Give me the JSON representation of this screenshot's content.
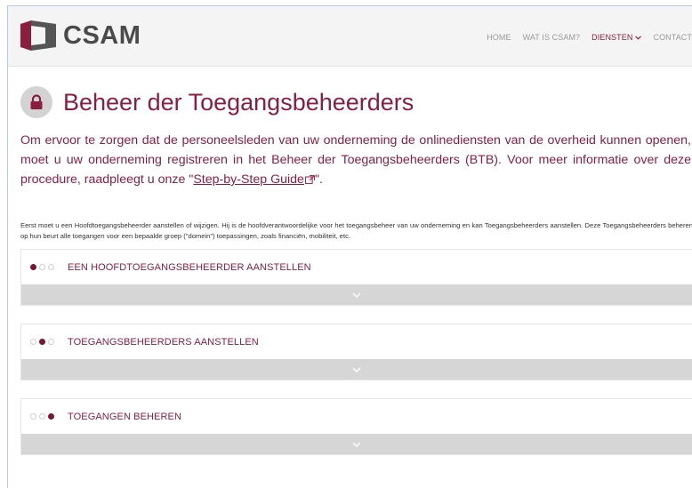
{
  "brand": {
    "name": "CSAM",
    "logo_icon": "csam-logo-icon",
    "accent": "#8b1e3f"
  },
  "nav": {
    "items": [
      {
        "label": "HOME"
      },
      {
        "label": "WAT IS CSAM?"
      },
      {
        "label": "DIENSTEN",
        "active": true,
        "chevron": "⌄"
      },
      {
        "label": "CONTACT"
      }
    ]
  },
  "page": {
    "title": "Beheer der Toegangsbeheerders",
    "icon": "lock-icon",
    "intro_before": "Om ervoor te zorgen dat de personeelsleden van uw onderneming de onlinediensten van de overheid kunnen openen, moet u uw onderneming registreren in het Beheer der Toegangsbeheerders (BTB). Voor meer informatie over deze procedure, raadpleegt u onze \"",
    "intro_link": "Step-by-Step Guide",
    "intro_after": "\".",
    "body": "Eerst moet u een Hoofdtoegangsbeheerder aanstellen of wijzigen. Hij is de hoofdverantwoordelijke voor het toegangsbeheer van uw onderneming en kan Toegangsbeheerders aanstellen. Deze Toegangsbeheerders beheren op hun beurt alle toegangen voor een bepaalde groep (\"domein\") toepassingen, zoals financiën, mobiliteit, etc."
  },
  "steps": [
    {
      "label": "EEN HOOFDTOEGANGSBEHEERDER AANSTELLEN",
      "active_dot": 0
    },
    {
      "label": "TOEGANGSBEHEERDERS AANSTELLEN",
      "active_dot": 1
    },
    {
      "label": "TOEGANGEN BEHEREN",
      "active_dot": 2
    }
  ]
}
